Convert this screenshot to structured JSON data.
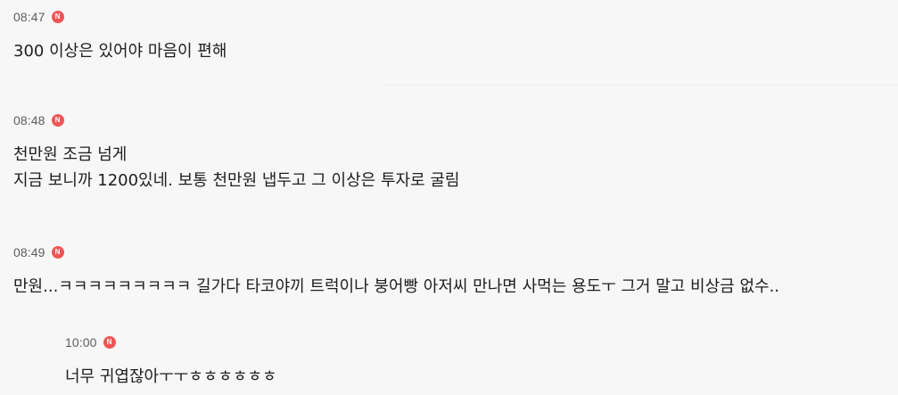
{
  "comments": [
    {
      "time": "08:47",
      "badge": "N",
      "lines": [
        "300 이상은 있어야 마음이 편해"
      ]
    },
    {
      "time": "08:48",
      "badge": "N",
      "lines": [
        "천만원 조금 넘게",
        "지금 보니까 1200있네. 보통 천만원 냅두고 그 이상은 투자로 굴림"
      ]
    },
    {
      "time": "08:49",
      "badge": "N",
      "lines": [
        "만원...ㅋㅋㅋㅋㅋㅋㅋㅋㅋ 길가다 타코야끼 트럭이나 붕어빵 아저씨 만나면 사먹는 용도ㅜ 그거 말고 비상금 없수.."
      ]
    }
  ],
  "reply": {
    "time": "10:00",
    "badge": "N",
    "lines": [
      "너무 귀엽잖아ㅜㅜㅎㅎㅎㅎㅎㅎ"
    ]
  },
  "colors": {
    "background": "#f7f7f7",
    "badge": "#f05656",
    "time_text": "#5d5d5d",
    "body_text": "#1e1e1e"
  },
  "icons": {
    "new_badge": "new-badge-icon"
  }
}
